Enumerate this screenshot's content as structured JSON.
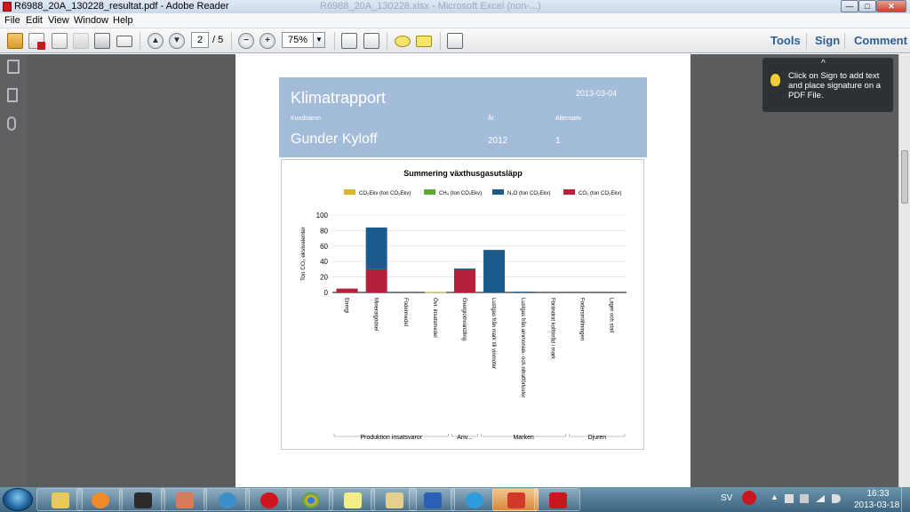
{
  "window": {
    "title": "R6988_20A_130228_resultat.pdf - Adobe Reader",
    "background_title": "R6988_20A_130228.xlsx - Microsoft Excel (non-...)"
  },
  "menu": [
    "File",
    "Edit",
    "View",
    "Window",
    "Help"
  ],
  "toolbar": {
    "page_current": "2",
    "page_total": "/ 5",
    "zoom": "75%",
    "right_links": [
      "Tools",
      "Sign",
      "Comment"
    ]
  },
  "sign_tooltip": {
    "text": "Click on Sign to add text and place signature on a PDF File."
  },
  "report": {
    "title": "Klimatrapport",
    "date": "2013-03-04",
    "label_customer": "Kundnamn",
    "label_year": "År",
    "label_alt": "Alternativ",
    "customer": "Gunder Kyloff",
    "year": "2012",
    "alternative": "1"
  },
  "chart_data": {
    "type": "bar",
    "stacked": true,
    "title": "Summering växthusgasutsläpp",
    "ylabel": "Ton CO₂ ekvivalenter",
    "ylim": [
      0,
      100
    ],
    "yticks": [
      0,
      20,
      40,
      60,
      80,
      100
    ],
    "legend_position": "top",
    "categories": [
      "Energi",
      "Mineralgödsel",
      "Fodermedel",
      "Övr. insatsmedel",
      "Energiomvandling",
      "Lustgas från mark till vinmoter",
      "Lustgas från ammoniak- och nitratförluster",
      "Förändrat kolförråd i mark",
      "Fodersmältningen",
      "Lager och stall"
    ],
    "series": [
      {
        "name": "CO₂Ekv (ton CO₂Ekv)",
        "color": "#d4b62b",
        "values": [
          0,
          0,
          0,
          0.5,
          0,
          0,
          0,
          0,
          0,
          0
        ]
      },
      {
        "name": "CH₄ (ton CO₂Ekv)",
        "color": "#5fa82f",
        "values": [
          0,
          0,
          0,
          0,
          0,
          0,
          0,
          0,
          0,
          0
        ]
      },
      {
        "name": "N₂O (ton CO₂Ekv)",
        "color": "#1b5a8a",
        "values": [
          0,
          54,
          0,
          0,
          1,
          55,
          1,
          0,
          0,
          0
        ]
      },
      {
        "name": "CO₂ (ton CO₂Ekv)",
        "color": "#b5203a",
        "values": [
          5,
          30,
          0,
          0,
          30,
          0,
          0,
          0,
          0,
          0
        ]
      }
    ],
    "groups": [
      {
        "label": "Produktion insatsvaror",
        "from": 0,
        "to": 3
      },
      {
        "label": "Anv...",
        "from": 4,
        "to": 4
      },
      {
        "label": "Marken",
        "from": 5,
        "to": 7
      },
      {
        "label": "Djuren",
        "from": 8,
        "to": 9
      }
    ]
  },
  "taskbar": {
    "apps": [
      "explorer",
      "media-player",
      "webcam",
      "printer",
      "hp",
      "opera",
      "chrome",
      "sticky-notes",
      "folder",
      "word",
      "internet-explorer",
      "autocad",
      "acrobat"
    ],
    "language": "SV",
    "time": "16:33",
    "date": "2013-03-18"
  },
  "colors": {
    "header_bg": "#a3bcd9",
    "link": "#2c5d94",
    "doc_bg": "#5b5c5e"
  }
}
